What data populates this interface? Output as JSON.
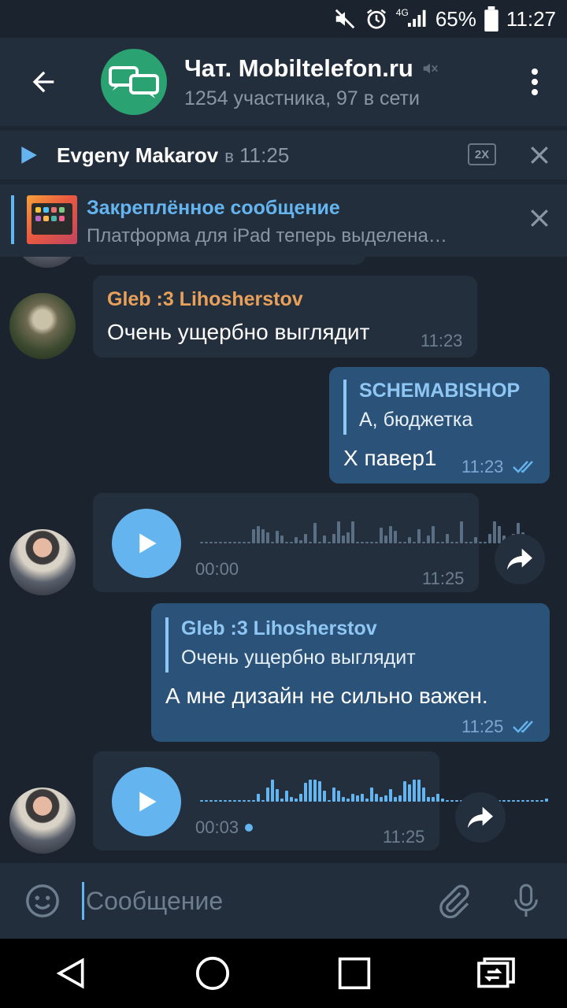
{
  "status": {
    "net": "4G",
    "battery": "65%",
    "time": "11:27"
  },
  "header": {
    "title": "Чат. Mobiltelefon.ru",
    "subtitle": "1254 участника, 97 в сети"
  },
  "audio_player": {
    "name": "Evgeny Makarov",
    "at": "в",
    "time": "11:25",
    "speed": "2X"
  },
  "pinned": {
    "title": "Закреплённое сообщение",
    "text": "Платформа для iPad теперь выделена…"
  },
  "messages": [
    {
      "type": "text",
      "dir": "in",
      "sender": "Gleb :3 Lihosherstov",
      "sender_color": "#e8a05a",
      "text": "Очень ущербно выглядит",
      "time": "11:23"
    },
    {
      "type": "reply",
      "dir": "out",
      "reply_name": "SCHEMABISHOP",
      "reply_text": "А, бюджетка",
      "text": "Х павер1",
      "time": "11:23"
    },
    {
      "type": "voice",
      "dir": "in",
      "duration": "00:00",
      "time": "11:25",
      "played": 0
    },
    {
      "type": "reply",
      "dir": "out",
      "reply_name": "Gleb :3 Lihosherstov",
      "reply_text": "Очень ущербно выглядит",
      "text": "А мне дизайн не сильно важен.",
      "time": "11:25"
    },
    {
      "type": "voice",
      "dir": "in",
      "duration": "00:03",
      "time": "11:25",
      "played": 1
    }
  ],
  "composer": {
    "placeholder": "Сообщение"
  },
  "colors": {
    "accent": "#64b5ef",
    "out_bubble": "#2b5278",
    "in_bubble": "#242f3d",
    "avatar_bg": "#2aa271"
  }
}
